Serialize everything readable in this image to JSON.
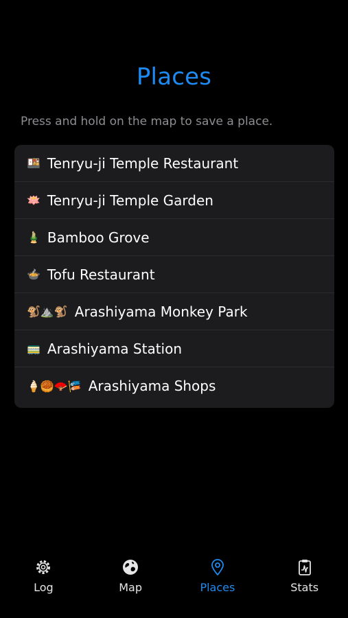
{
  "header": {
    "title": "Places",
    "hint": "Press and hold on the map to save a place."
  },
  "places": [
    {
      "emoji": "🍱",
      "name": "Tenryu-ji Temple Restaurant"
    },
    {
      "emoji": "🪷",
      "name": "Tenryu-ji Temple Garden"
    },
    {
      "emoji": "🎍",
      "name": "Bamboo Grove"
    },
    {
      "emoji": "🍲",
      "name": "Tofu Restaurant"
    },
    {
      "emoji": "🐒⛰️🐒",
      "name": "Arashiyama Monkey Park"
    },
    {
      "emoji": "🚃",
      "name": "Arashiyama Station"
    },
    {
      "emoji": "🍦🥮🪭🎏",
      "name": "Arashiyama Shops"
    }
  ],
  "tabbar": {
    "tabs": [
      {
        "label": "Log",
        "icon": "gear-icon"
      },
      {
        "label": "Map",
        "icon": "globe-icon"
      },
      {
        "label": "Places",
        "icon": "location-pin-icon"
      },
      {
        "label": "Stats",
        "icon": "clipboard-chart-icon"
      }
    ],
    "active_tab": "Places"
  },
  "colors": {
    "accent": "#1e8bf2",
    "background": "#000000",
    "list_background": "#1c1c1e",
    "secondary_text": "#8d8d92"
  }
}
